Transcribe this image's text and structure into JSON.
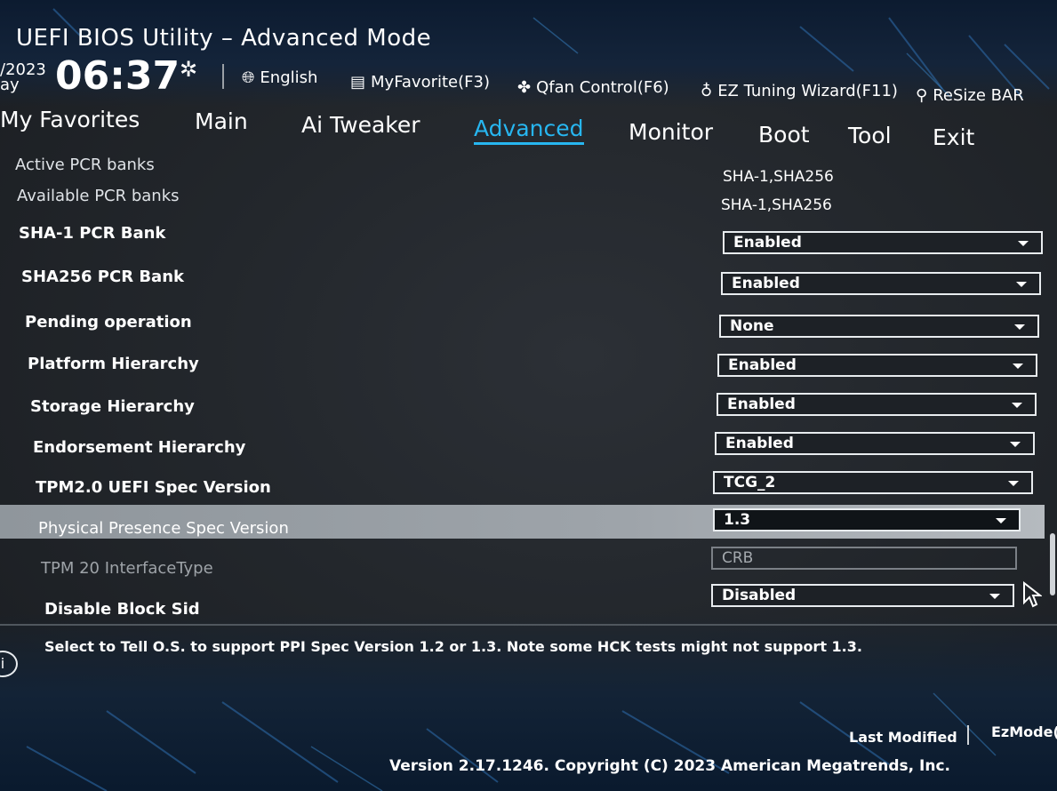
{
  "header": {
    "title": "UEFI BIOS Utility – Advanced Mode",
    "date_line1": "/2023",
    "date_line2": "ay",
    "time": "06:37",
    "settings_icon": "gear-icon",
    "toolbar": [
      {
        "label": "English",
        "icon": "globe-icon"
      },
      {
        "label": "MyFavorite(F3)",
        "icon": "list-icon"
      },
      {
        "label": "Qfan Control(F6)",
        "icon": "fan-icon"
      },
      {
        "label": "EZ Tuning Wizard(F11)",
        "icon": "bulb-icon"
      },
      {
        "label": "ReSize BAR",
        "icon": "resize-bar-icon"
      }
    ]
  },
  "tabs": [
    "My Favorites",
    "Main",
    "Ai Tweaker",
    "Advanced",
    "Monitor",
    "Boot",
    "Tool",
    "Exit"
  ],
  "active_tab": "Advanced",
  "settings": {
    "info_rows": [
      {
        "label": "Active PCR banks",
        "value": "SHA-1,SHA256"
      },
      {
        "label": "Available PCR banks",
        "value": "SHA-1,SHA256"
      }
    ],
    "rows": [
      {
        "label": "SHA-1 PCR Bank",
        "value": "Enabled"
      },
      {
        "label": "SHA256 PCR Bank",
        "value": "Enabled"
      },
      {
        "label": "Pending operation",
        "value": "None"
      },
      {
        "label": "Platform Hierarchy",
        "value": "Enabled"
      },
      {
        "label": "Storage Hierarchy",
        "value": "Enabled"
      },
      {
        "label": "Endorsement Hierarchy",
        "value": "Enabled"
      },
      {
        "label": "TPM2.0 UEFI Spec Version",
        "value": "TCG_2"
      },
      {
        "label": "Physical Presence Spec Version",
        "value": "1.3"
      },
      {
        "label": "TPM 20 InterfaceType",
        "value": "CRB"
      },
      {
        "label": "Disable Block Sid",
        "value": "Disabled"
      }
    ]
  },
  "help_text": "Select to Tell O.S. to support PPI Spec Version 1.2 or 1.3. Note some HCK tests might not support 1.3.",
  "footer": {
    "last_modified": "Last Modified",
    "ezmode": "EzMode(F",
    "version": "Version 2.17.1246. Copyright (C) 2023 American Megatrends, Inc."
  },
  "colors": {
    "accent": "#27b6f0",
    "highlight": "#9ea4aa"
  }
}
